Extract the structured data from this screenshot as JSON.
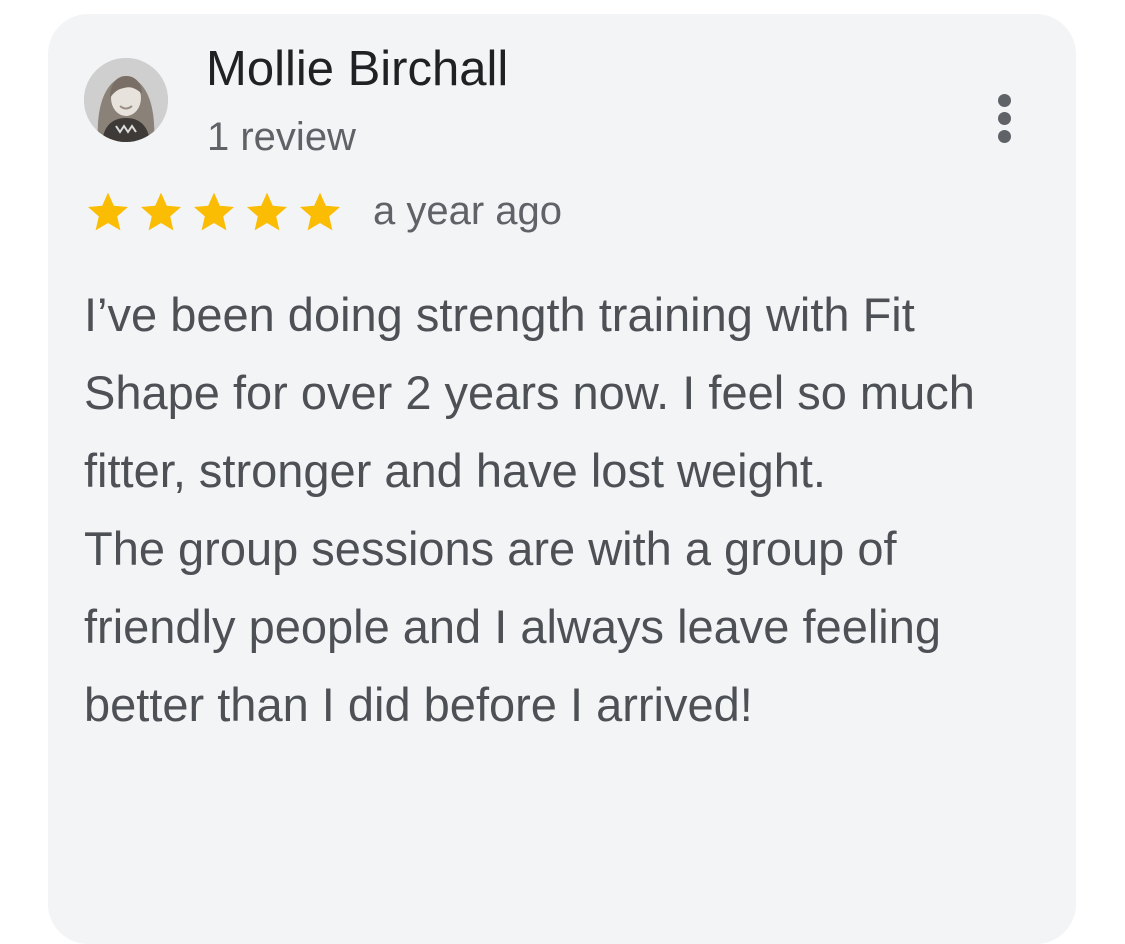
{
  "review": {
    "author_name": "Mollie Birchall",
    "review_count": "1 review",
    "rating": 5,
    "rating_max": 5,
    "relative_time": "a year ago",
    "text_paragraph_1": "I’ve been doing strength training with Fit Shape for over 2 years now. I feel so much fitter, stronger and have lost weight.",
    "text_paragraph_2": "The group sessions are with a group of friendly people and I always leave feeling better than I did before I arrived!"
  },
  "colors": {
    "card_background": "#f3f4f6",
    "star": "#fbbc04",
    "name_text": "#202124",
    "secondary_text": "#5f6368",
    "body_text": "#4d5156"
  },
  "icons": {
    "avatar": "avatar-photo",
    "more": "more-vert-icon",
    "star": "star-icon"
  }
}
